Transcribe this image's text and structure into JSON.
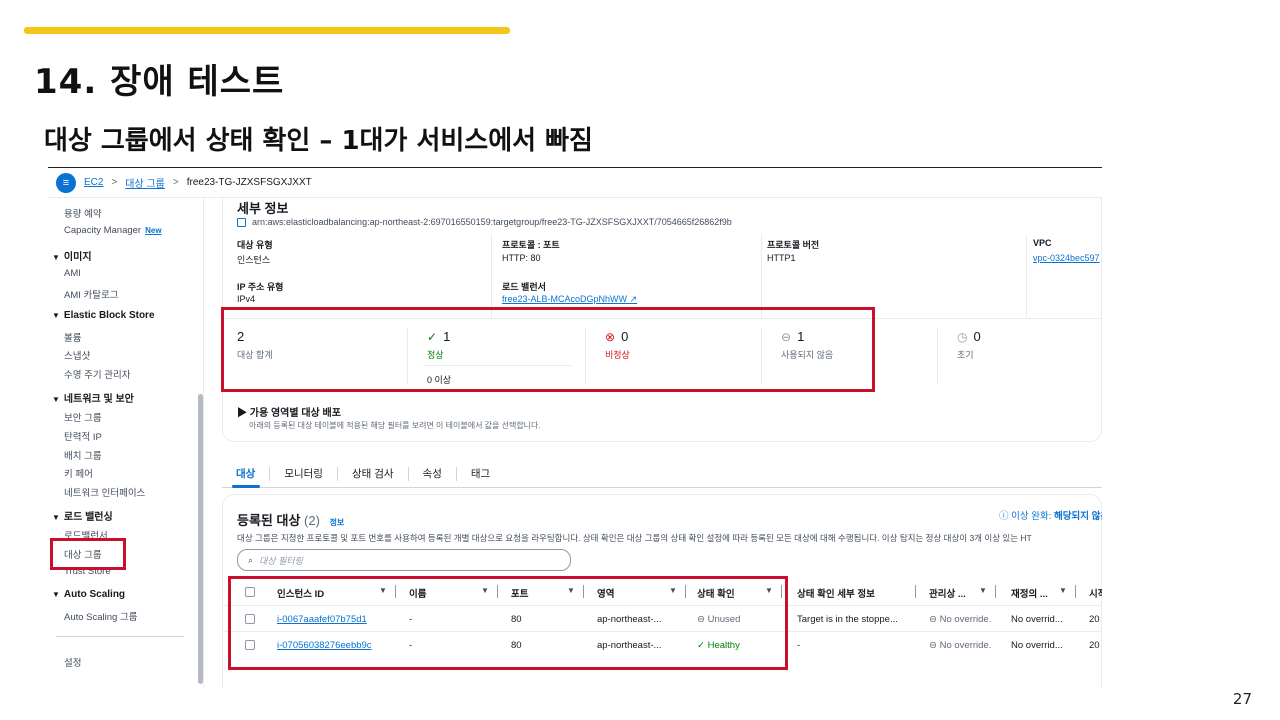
{
  "slide": {
    "title": "14. 장애 테스트",
    "subtitle": "대상 그룹에서 상태 확인 – 1대가 서비스에서 빠짐",
    "page_number": "27"
  },
  "breadcrumb": {
    "menu_icon": "hamburger-menu-icon",
    "items": [
      "EC2",
      "대상 그룹",
      "free23-TG-JZXSFSGXJXXT"
    ],
    "separator": ">"
  },
  "nav": {
    "top_items": [
      "용량 예약",
      "Capacity Manager"
    ],
    "new_badge": "New",
    "sections": [
      {
        "title": "이미지",
        "items": [
          "AMI",
          "AMI 카탈로그"
        ]
      },
      {
        "title": "Elastic Block Store",
        "items": [
          "볼륨",
          "스냅샷",
          "수명 주기 관리자"
        ]
      },
      {
        "title": "네트워크 및 보안",
        "items": [
          "보안 그룹",
          "탄력적 IP",
          "배치 그룹",
          "키 페어",
          "네트워크 인터페이스"
        ]
      },
      {
        "title": "로드 밸런싱",
        "items": [
          "로드밸런서",
          "대상 그룹",
          "Trust Store"
        ]
      },
      {
        "title": "Auto Scaling",
        "items": [
          "Auto Scaling 그룹"
        ]
      }
    ],
    "settings": "설정"
  },
  "details": {
    "title": "세부 정보",
    "arn": "arn:aws:elasticloadbalancing:ap-northeast-2:697016550159:targetgroup/free23-TG-JZXSFSGXJXXT/7054665f26862f9b",
    "fields": {
      "target_type_label": "대상 유형",
      "target_type": "인스턴스",
      "protocol_port_label": "프로토콜 : 포트",
      "protocol_port": "HTTP: 80",
      "protocol_version_label": "프로토콜 버전",
      "protocol_version": "HTTP1",
      "vpc_label": "VPC",
      "vpc": "vpc-0324bec597",
      "ip_type_label": "IP 주소 유형",
      "ip_type": "IPv4",
      "lb_label": "로드 밸런서",
      "lb": "free23-ALB-MCAcoDGpNhWW"
    },
    "stats": {
      "total": "2",
      "total_label": "대상 합계",
      "healthy": "1",
      "healthy_label": "정상",
      "unhealthy": "0",
      "unhealthy_label": "비정상",
      "unused": "1",
      "unused_label": "사용되지 않음",
      "initial": "0",
      "initial_label": "초기",
      "anomalous": "0 이상"
    },
    "az_title": "가용 영역별 대상 배포",
    "az_desc": "아래의 등록된 대상 테이블에 적용된 해당 필터를 보려면 이 테이블에서 값을 선택합니다."
  },
  "tabs": [
    "대상",
    "모니터링",
    "상태 검사",
    "속성",
    "태그"
  ],
  "registered": {
    "title": "등록된 대상",
    "count": "(2)",
    "info": "정보",
    "mitigation": "이상 완화:",
    "mitigation_value": "해당되지 않음",
    "desc": "대상 그룹은 지정한 프로토콜 및 포트 번호를 사용하여 등록된 개별 대상으로 요청을 라우팅합니다. 상태 확인은 대상 그룹의 상태 확인 설정에 따라 등록된 모든 대상에 대해 수행됩니다. 이상 탐지는 정상 대상이 3개 이상 있는 HT",
    "filter_placeholder": "대상 필터링",
    "columns": [
      "인스턴스 ID",
      "이름",
      "포트",
      "영역",
      "상태 확인",
      "상태 확인 세부 정보",
      "관리상 ...",
      "재정의 ...",
      "시작"
    ],
    "rows": [
      {
        "id": "i-0067aaafef07b75d1",
        "name": "-",
        "port": "80",
        "zone": "ap-northeast-...",
        "health": "Unused",
        "detail": "Target is in the stoppe...",
        "admin": "No override.",
        "override": "No overrid...",
        "start": "20"
      },
      {
        "id": "i-07056038276eebb9c",
        "name": "-",
        "port": "80",
        "zone": "ap-northeast-...",
        "health": "Healthy",
        "detail": "-",
        "admin": "No override.",
        "override": "No overrid...",
        "start": "20"
      }
    ]
  }
}
